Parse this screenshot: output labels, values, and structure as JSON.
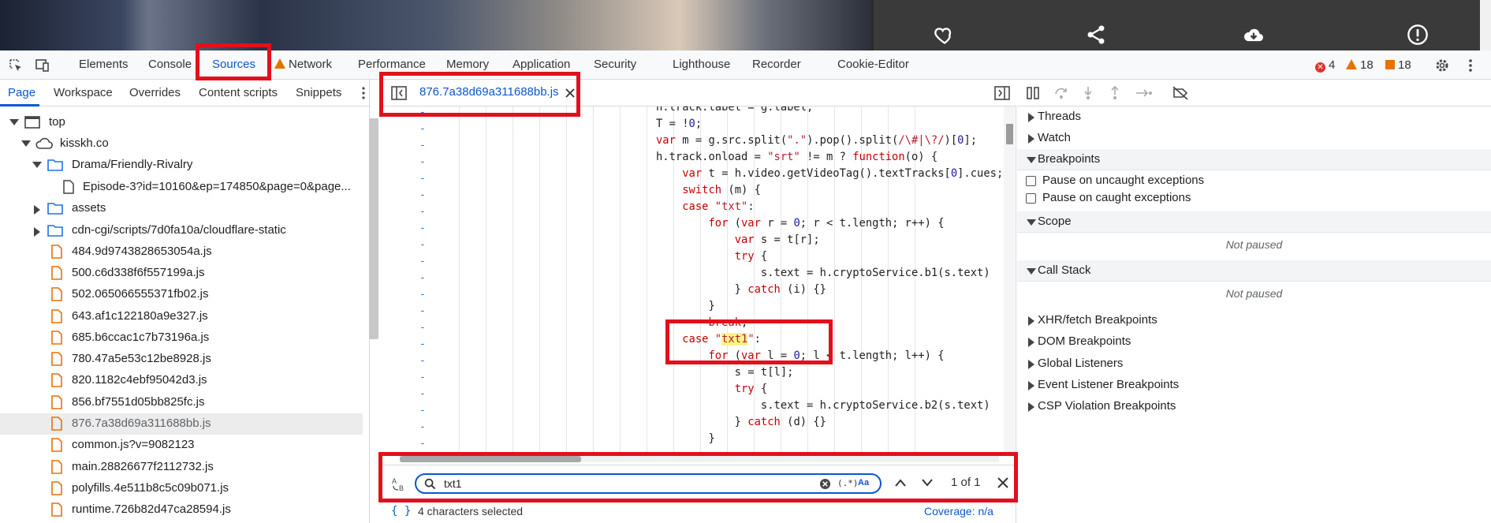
{
  "main_tabs": [
    "Elements",
    "Console",
    "Sources",
    "Network",
    "Performance",
    "Memory",
    "Application",
    "Security",
    "Lighthouse",
    "Recorder",
    "Cookie-Editor"
  ],
  "active_main_tab": "Sources",
  "status_counts": {
    "errors": "4",
    "warnings": "18",
    "issues": "18"
  },
  "navigator": {
    "tabs": [
      "Page",
      "Workspace",
      "Overrides",
      "Content scripts",
      "Snippets"
    ],
    "active_tab": "Page",
    "tree": [
      {
        "label": "top",
        "type": "frame",
        "depth": 0,
        "expanded": true
      },
      {
        "label": "kisskh.co",
        "type": "cloud",
        "depth": 1,
        "expanded": true
      },
      {
        "label": "Drama/Friendly-Rivalry",
        "type": "folder",
        "depth": 2,
        "expanded": true
      },
      {
        "label": "Episode-3?id=10160&ep=174850&page=0&page...",
        "type": "doc",
        "depth": 3
      },
      {
        "label": "assets",
        "type": "folder",
        "depth": 2,
        "expanded": false
      },
      {
        "label": "cdn-cgi/scripts/7d0fa10a/cloudflare-static",
        "type": "folder",
        "depth": 2,
        "expanded": false
      },
      {
        "label": "484.9d9743828653054a.js",
        "type": "js",
        "depth": 2
      },
      {
        "label": "500.c6d338f6f557199a.js",
        "type": "js",
        "depth": 2
      },
      {
        "label": "502.065066555371fb02.js",
        "type": "js",
        "depth": 2
      },
      {
        "label": "643.af1c122180a9e327.js",
        "type": "js",
        "depth": 2
      },
      {
        "label": "685.b6ccac1c7b73196a.js",
        "type": "js",
        "depth": 2
      },
      {
        "label": "780.47a5e53c12be8928.js",
        "type": "js",
        "depth": 2
      },
      {
        "label": "820.1182c4ebf95042d3.js",
        "type": "js",
        "depth": 2
      },
      {
        "label": "856.bf7551d05bb825fc.js",
        "type": "js",
        "depth": 2
      },
      {
        "label": "876.7a38d69a311688bb.js",
        "type": "js",
        "depth": 2,
        "selected": true
      },
      {
        "label": "common.js?v=9082123",
        "type": "js",
        "depth": 2
      },
      {
        "label": "main.28826677f2112732.js",
        "type": "js",
        "depth": 2
      },
      {
        "label": "polyfills.4e511b8c5c09b071.js",
        "type": "js",
        "depth": 2
      },
      {
        "label": "runtime.726b82d47ca28594.js",
        "type": "js",
        "depth": 2
      }
    ]
  },
  "editor": {
    "file_tab": "876.7a38d69a311688bb.js",
    "line_marker": "-",
    "code_lines": [
      "h.track.label = g.label,",
      "T = !0;",
      "var m = g.src.split(\".\").pop().split(/\\#|\\?/)[0];",
      "h.track.onload = \"srt\" != m ? function(o) {",
      "    var t = h.video.getVideoTag().textTracks[0].cues;",
      "    switch (m) {",
      "    case \"txt\":",
      "        for (var r = 0; r < t.length; r++) {",
      "            var s = t[r];",
      "            try {",
      "                s.text = h.cryptoService.b1(s.text)",
      "            } catch (i) {}",
      "        }",
      "        break;",
      "    case \"txt1\":",
      "        for (var l = 0; l < t.length; l++) {",
      "            s = t[l];",
      "            try {",
      "                s.text = h.cryptoService.b2(s.text)",
      "            } catch (d) {}",
      "        }"
    ],
    "search": {
      "value": "txt1",
      "match_count": "1 of 1"
    },
    "status_left": "4 characters selected",
    "coverage": "Coverage: n/a"
  },
  "debugger": {
    "sections": [
      {
        "label": "Threads",
        "expanded": false
      },
      {
        "label": "Watch",
        "expanded": false
      },
      {
        "label": "Breakpoints",
        "expanded": true
      },
      {
        "label": "Scope",
        "expanded": true
      },
      {
        "label": "Call Stack",
        "expanded": true
      },
      {
        "label": "XHR/fetch Breakpoints",
        "expanded": false
      },
      {
        "label": "DOM Breakpoints",
        "expanded": false
      },
      {
        "label": "Global Listeners",
        "expanded": false
      },
      {
        "label": "Event Listener Breakpoints",
        "expanded": false
      },
      {
        "label": "CSP Violation Breakpoints",
        "expanded": false
      }
    ],
    "pause_uncaught": "Pause on uncaught exceptions",
    "pause_caught": "Pause on caught exceptions",
    "not_paused": "Not paused"
  },
  "colors": {
    "accent": "#0b57d0",
    "annotation": "#e3101c",
    "error": "#dc362e",
    "warning": "#e37400"
  }
}
